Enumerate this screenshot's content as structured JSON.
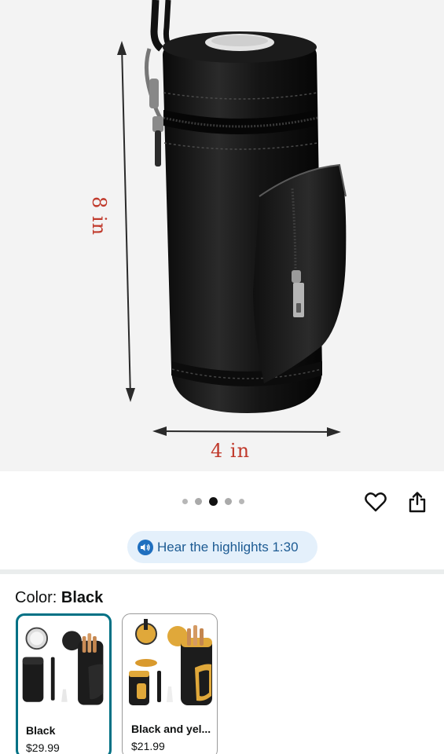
{
  "product_image": {
    "alt": "Black leather cylindrical travel case with zipper pocket",
    "dimension_height": "8 in",
    "dimension_width": "4 in"
  },
  "carousel": {
    "dot_count": 5,
    "active_index": 2
  },
  "actions": {
    "wishlist_icon": "heart-icon",
    "share_icon": "share-icon"
  },
  "audio": {
    "label": "Hear the highlights 1:30",
    "icon": "speaker-icon"
  },
  "variation": {
    "prefix": "Color: ",
    "selected": "Black",
    "options": [
      {
        "name": "Black",
        "price": "$29.99",
        "selected": true
      },
      {
        "name": "Black and yel...",
        "price": "$21.99",
        "selected": false
      }
    ]
  },
  "colors": {
    "selected_border": "#007185",
    "audio_pill_bg": "#e4f0fb",
    "audio_text": "#1d5b93",
    "dimension_text": "#c0392b"
  }
}
